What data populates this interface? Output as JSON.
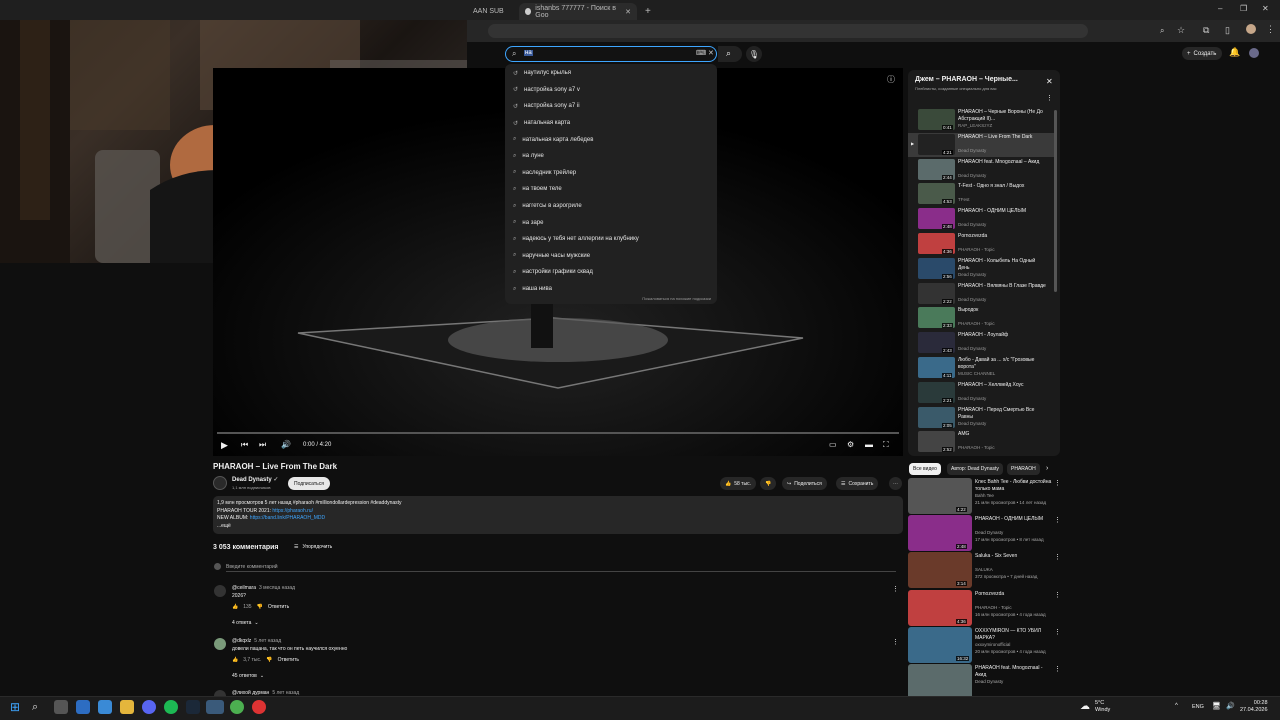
{
  "browser": {
    "tabs": [
      {
        "label": "AAN SUB"
      },
      {
        "label": "ishanbs 777777 - Поиск в Goo"
      }
    ],
    "new_tab": "+"
  },
  "youtube": {
    "search_value": "на",
    "create_label": "Создать",
    "suggestions": [
      {
        "text": "наутилус крылья",
        "kind": "history"
      },
      {
        "text": "настройка sony a7 v",
        "kind": "history"
      },
      {
        "text": "настройка sony a7 ii",
        "kind": "history"
      },
      {
        "text": "натальная карта",
        "kind": "history"
      },
      {
        "text": "натальная карта лебедев",
        "kind": "search"
      },
      {
        "text": "на луне",
        "kind": "search"
      },
      {
        "text": "наследник трейлер",
        "kind": "search"
      },
      {
        "text": "на твоем теле",
        "kind": "search"
      },
      {
        "text": "наггетсы в аэрогриле",
        "kind": "search"
      },
      {
        "text": "на заре",
        "kind": "search"
      },
      {
        "text": "надеюсь у тебя нет аллергии на клубнику",
        "kind": "search"
      },
      {
        "text": "наручные часы мужские",
        "kind": "search"
      },
      {
        "text": "настройки графики сквад",
        "kind": "search"
      },
      {
        "text": "наша нива",
        "kind": "search"
      }
    ],
    "suggestions_footer": "Пожаловаться на похожие подсказки"
  },
  "player": {
    "time": "0:00 / 4:20",
    "progress": 0
  },
  "video": {
    "title": "PHARAOH – Live From The Dark",
    "channel": "Dead Dynasty",
    "subs": "1,1 млн подписчиков",
    "subscribe": "Подписаться",
    "likes": "58 тыс.",
    "share": "Поделиться",
    "save": "Сохранить",
    "desc_line1": "1,9 млн просмотров  5 лет назад  #pharaoh #milliondollardepression #deaddynasty",
    "desc_line2_prefix": "PHARAOH TOUR 2021: ",
    "desc_line2_link": "https://pharaoh.ru/",
    "desc_line3_prefix": "NEW ALBUM: ",
    "desc_line3_link": "https://band.link/PHARAOH_MDD",
    "desc_more": "...ещё"
  },
  "comments": {
    "count": "3 053 комментария",
    "sort": "Упорядочить",
    "input_placeholder": "Введите комментарий",
    "items": [
      {
        "author": "@ceilmara",
        "age": "3 месяца назад",
        "text": "2026?",
        "likes": "135",
        "reply": "Ответить",
        "replies": "4 ответа"
      },
      {
        "author": "@dkqxlz",
        "age": "5 лет назад",
        "text": "довели пацана, так что он петь научился охуенно",
        "likes": "3,7 тыс.",
        "reply": "Ответить",
        "replies": "45 ответов"
      },
      {
        "author": "@лихой дурман",
        "age": "5 лет назад",
        "text": "",
        "likes": "",
        "reply": "",
        "replies": ""
      }
    ]
  },
  "playlist": {
    "title": "Джем – PHARAOH – Черные...",
    "subtitle": "Плейлисты, созданные специально для вас",
    "items": [
      {
        "title": "PHARAOH – Черные Вороны (Не До Абстракций II)...",
        "channel": "RAP_LEAKSzYZ",
        "dur": "0:41",
        "color": "#3a4a3a"
      },
      {
        "title": "PHARAOH – Live From The Dark",
        "channel": "Dead Dynasty",
        "dur": "4:21",
        "color": "#222",
        "active": true
      },
      {
        "title": "PHARAOH feat. Mnogoznaal – Акид",
        "channel": "Dead Dynasty",
        "dur": "2:44",
        "color": "#5b6b6b"
      },
      {
        "title": "T-Fest - Одно я знал / Выдох",
        "channel": "TFest",
        "dur": "4:53",
        "color": "#4a5a4a"
      },
      {
        "title": "PHARAOH - ОДНИМ ЦЕЛЫМ",
        "channel": "Dead Dynasty",
        "dur": "2:48",
        "color": "#8a2d8a"
      },
      {
        "title": "Pornozvezda",
        "channel": "PHARAOH - Topic",
        "dur": "4:36",
        "color": "#c04040"
      },
      {
        "title": "PHARAOH - Колыбель На Одный День",
        "channel": "Dead Dynasty",
        "dur": "2:56",
        "color": "#2a4a6a"
      },
      {
        "title": "PHARAOH - Вялвяны В Глазе Правде",
        "channel": "Dead Dynasty",
        "dur": "2:22",
        "color": "#333"
      },
      {
        "title": "Выродок",
        "channel": "PHARAOH - Topic",
        "dur": "2:33",
        "color": "#4a7a5a"
      },
      {
        "title": "PHARAOH - Лоулайф",
        "channel": "Dead Dynasty",
        "dur": "2:43",
        "color": "#2a2a3a"
      },
      {
        "title": "Любо - Давай за ... x/c \"Грозовые ворота\"",
        "channel": "MUSIC CHANNEL",
        "dur": "4:11",
        "color": "#3a6a8a"
      },
      {
        "title": "PHARAOH – Хеллвейд Хоус",
        "channel": "Dead Dynasty",
        "dur": "2:21",
        "color": "#2a3a3a"
      },
      {
        "title": "PHARAOH - Перед Смертью Все Равны",
        "channel": "Dead Dynasty",
        "dur": "2:05",
        "color": "#3a5a6a"
      },
      {
        "title": "AMG",
        "channel": "PHARAOH - Topic",
        "dur": "2:52",
        "color": "#444"
      }
    ]
  },
  "chips": [
    "Все видео",
    "Автор: Dead Dynasty",
    "PHARAOH"
  ],
  "recommendations": [
    {
      "title": "Клес Bahh Tee - Любви достойна только мама",
      "channel": "Bahh Tee",
      "meta": "21 млн просмотров • 14 лет назад",
      "dur": "4:22",
      "color": "#555"
    },
    {
      "title": "PHARAOH - ОДНИМ ЦЕЛЫМ",
      "channel": "Dead Dynasty",
      "meta": "17 млн просмотров • 8 лет назад",
      "dur": "2:48",
      "color": "#8a2d8a"
    },
    {
      "title": "Saluka - Six Seven",
      "channel": "SALUKA",
      "meta": "372 просмотра • 7 дней назад",
      "dur": "3:14",
      "color": "#6a3a2a"
    },
    {
      "title": "Pornozvezda",
      "channel": "PHARAOH - Topic",
      "meta": "16 млн просмотров • 4 года назад",
      "dur": "4:36",
      "color": "#c04040"
    },
    {
      "title": "OXXXYMIRON — КТО УБИЛ МАРКА?",
      "channel": "oxxxymironofficial",
      "meta": "20 млн просмотров • 4 года назад",
      "dur": "16:32",
      "color": "#3a6a8a"
    },
    {
      "title": "PHARAOH feat. Mnogoznaal - Акид",
      "channel": "Dead Dynasty",
      "meta": "",
      "dur": "",
      "color": "#5b6b6b"
    }
  ],
  "taskbar": {
    "weather_temp": "5°C",
    "weather_text": "Windy",
    "lang": "ENG",
    "time": "00:28",
    "date": "27.04.2026"
  }
}
